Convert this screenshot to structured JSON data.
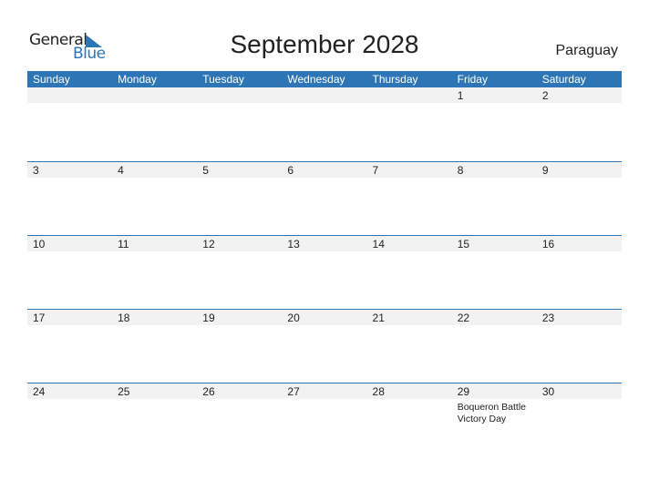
{
  "logo": {
    "general": "General",
    "blue": "Blue",
    "icon": "triangle-flag-icon"
  },
  "title": "September 2028",
  "country": "Paraguay",
  "colors": {
    "accent": "#2e75b6",
    "band": "#f2f2f2"
  },
  "weekdays": [
    "Sunday",
    "Monday",
    "Tuesday",
    "Wednesday",
    "Thursday",
    "Friday",
    "Saturday"
  ],
  "weeks": [
    {
      "days": [
        "",
        "",
        "",
        "",
        "",
        "1",
        "2"
      ],
      "holidays": [
        "",
        "",
        "",
        "",
        "",
        "",
        ""
      ]
    },
    {
      "days": [
        "3",
        "4",
        "5",
        "6",
        "7",
        "8",
        "9"
      ],
      "holidays": [
        "",
        "",
        "",
        "",
        "",
        "",
        ""
      ]
    },
    {
      "days": [
        "10",
        "11",
        "12",
        "13",
        "14",
        "15",
        "16"
      ],
      "holidays": [
        "",
        "",
        "",
        "",
        "",
        "",
        ""
      ]
    },
    {
      "days": [
        "17",
        "18",
        "19",
        "20",
        "21",
        "22",
        "23"
      ],
      "holidays": [
        "",
        "",
        "",
        "",
        "",
        "",
        ""
      ]
    },
    {
      "days": [
        "24",
        "25",
        "26",
        "27",
        "28",
        "29",
        "30"
      ],
      "holidays": [
        "",
        "",
        "",
        "",
        "",
        "Boqueron Battle Victory Day",
        ""
      ]
    }
  ]
}
